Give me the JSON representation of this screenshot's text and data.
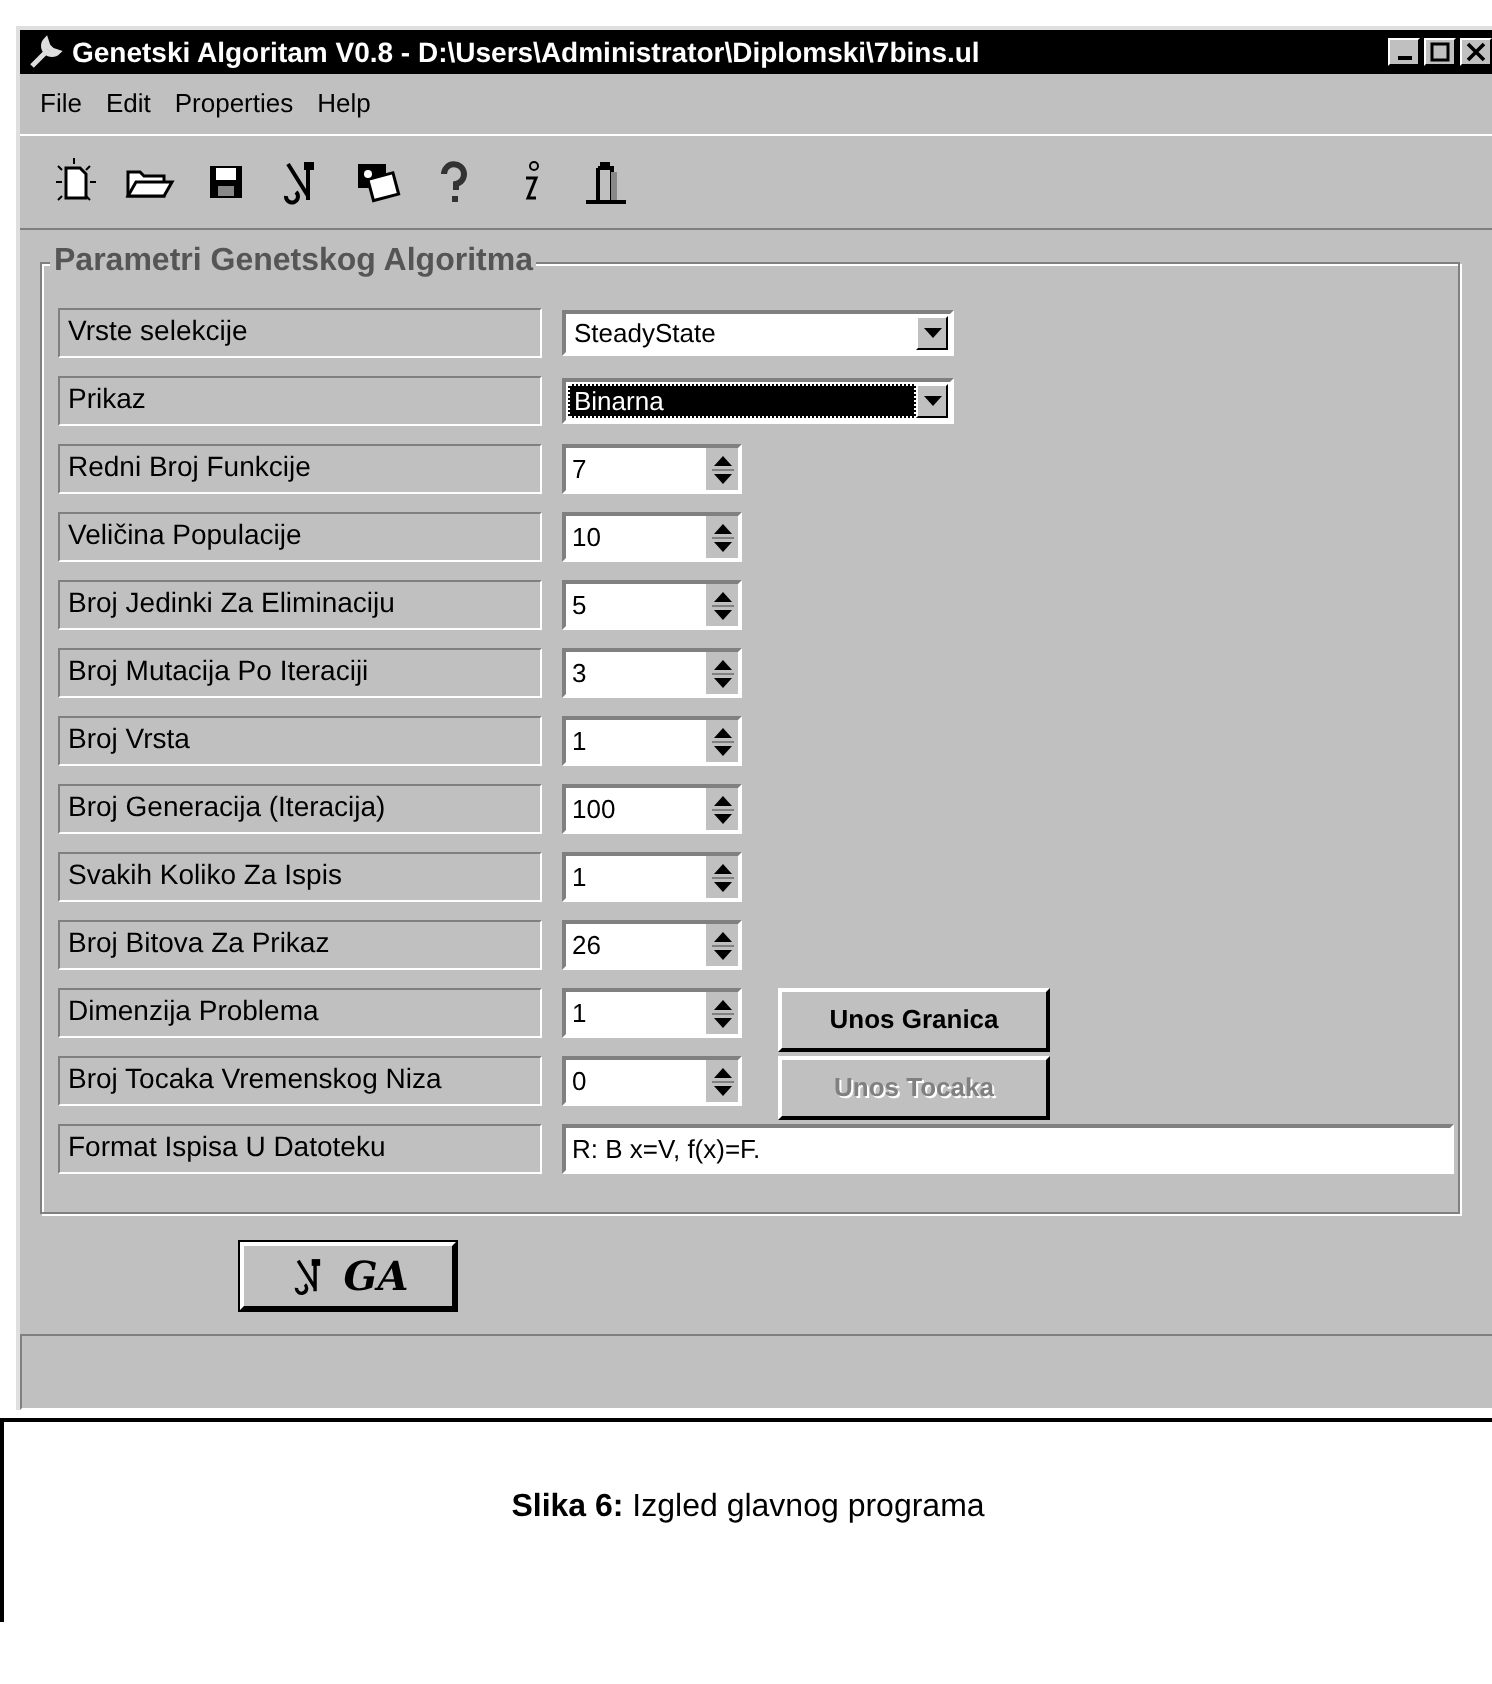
{
  "window": {
    "title": "Genetski Algoritam V0.8 - D:\\Users\\Administrator\\Diplomski\\7bins.ul"
  },
  "menu": [
    {
      "label": "File"
    },
    {
      "label": "Edit"
    },
    {
      "label": "Properties"
    },
    {
      "label": "Help"
    }
  ],
  "toolbar": [
    {
      "kind": "new"
    },
    {
      "kind": "open"
    },
    {
      "kind": "save"
    },
    {
      "kind": "tools"
    },
    {
      "kind": "cards"
    },
    {
      "kind": "help"
    },
    {
      "kind": "info"
    },
    {
      "kind": "exit"
    }
  ],
  "group": {
    "title": "Parametri Genetskog Algoritma"
  },
  "fields": [
    {
      "label": "Vrste selekcije",
      "kind": "combo",
      "value": "SteadyState",
      "focused": false
    },
    {
      "label": "Prikaz",
      "kind": "combo",
      "value": "Binarna",
      "focused": true
    },
    {
      "label": "Redni Broj Funkcije",
      "kind": "spin",
      "value": "7"
    },
    {
      "label": "Veličina Populacije",
      "kind": "spin",
      "value": "10"
    },
    {
      "label": "Broj Jedinki Za Eliminaciju",
      "kind": "spin",
      "value": "5"
    },
    {
      "label": "Broj Mutacija Po Iteraciji",
      "kind": "spin",
      "value": "3"
    },
    {
      "label": "Broj Vrsta",
      "kind": "spin",
      "value": "1"
    },
    {
      "label": "Broj Generacija (Iteracija)",
      "kind": "spin",
      "value": "100"
    },
    {
      "label": "Svakih Koliko Za Ispis",
      "kind": "spin",
      "value": "1"
    },
    {
      "label": "Broj Bitova Za Prikaz",
      "kind": "spin",
      "value": "26"
    },
    {
      "label": "Dimenzija Problema",
      "kind": "spin",
      "value": "1",
      "button": {
        "label": "Unos Granica",
        "disabled": false
      }
    },
    {
      "label": "Broj Tocaka Vremenskog Niza",
      "kind": "spin",
      "value": "0",
      "button": {
        "label": "Unos Tocaka",
        "disabled": true
      }
    },
    {
      "label": "Format Ispisa U Datoteku",
      "kind": "text",
      "value": "R: B x=V, f(x)=F."
    }
  ],
  "run_button": {
    "label": "GA"
  },
  "caption": {
    "text": "**Slika 6:** Izgled glavnog programa"
  }
}
